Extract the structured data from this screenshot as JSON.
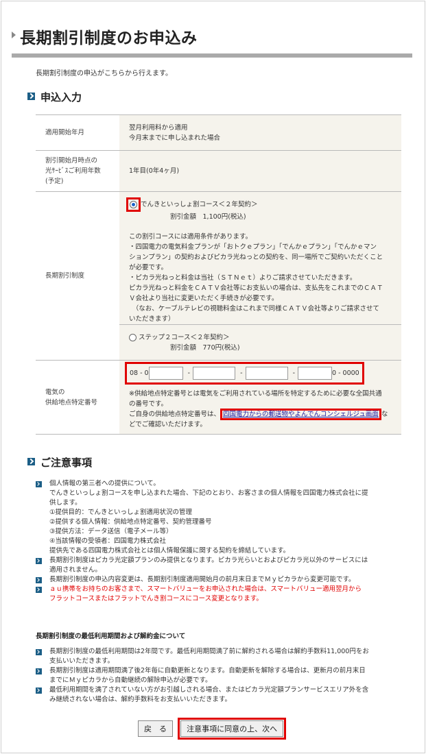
{
  "page": {
    "title": "長期割引制度のお申込み",
    "intro": "長期割引制度の申込がこちらから行えます。"
  },
  "sections": {
    "input_title": "申込入力",
    "notes_title": "ご注意事項"
  },
  "form": {
    "start_label": "適用開始年月",
    "start_value_1": "翌月利用料から適用",
    "start_value_2": "今月末までに申し込まれた場合",
    "years_label_1": "割引開始月時点の",
    "years_label_2": "光ｻｰﾋﾞｽご利用年数",
    "years_label_3": "(予定)",
    "years_value": "1年目(0年4ヶ月)",
    "plan_label": "長期割引制度",
    "option1_label": "でんきといっしょ割コース＜２年契約＞",
    "option1_amount": "割引金額　1,100円(税込)",
    "condition_lines": [
      "この割引コースには適用条件があります。",
      "・四国電力の電気料金プランが「おトクｅプラン」「でんかｅプラン」「でんかｅマン",
      "ションプラン」の契約およびピカラ光ねっとの契約を、同一場所でご契約いただくこと",
      "が必要です。",
      "・ピカラ光ねっと料金は当社（ＳＴＮｅｔ）よりご請求させていただきます。",
      "ピカラ光ねっと料金をＣＡＴＶ会社等にお支払いの場合は、支払先をこれまでのＣＡＴ",
      "Ｖ会社より当社に変更いただく手続きが必要です。",
      "　（なお、ケーブルテレビの視聴料金はこれまで同様ＣＡＴＶ会社等よりご請求させて",
      "いただきます）"
    ],
    "option2_label": "ステップ２コース＜２年契約＞",
    "option2_amount": "割引金額　770円(税込)",
    "supply_label_1": "電気の",
    "supply_label_2": "供給地点特定番号",
    "supply_prefix": "08 - 0",
    "supply_dash": "-",
    "supply_suffix": "0 - 0000",
    "supply_note_1": "※供給地点特定番号とは電気をご利用されている場所を特定するために必要な全国共通",
    "supply_note_2": "の番号です。",
    "supply_note_3": "ご自身の供給地点特定番号は、",
    "supply_link": "四国電力からの郵送物やよんでんコンシェルジュ画面",
    "supply_note_4": "な",
    "supply_note_5": "どでご確認いただけます。"
  },
  "notes": [
    {
      "lines": [
        "個人情報の第三者への提供について。",
        "でんきといっしょ割コースを申し込まれた場合、下記のとおり、お客さまの個人情報を四国電力株式会社に提",
        "供します。",
        "①提供目的：でんきといっしょ割適用状況の管理",
        "②提供する個人情報：供給地点特定番号、契約管理番号",
        "③提供方法：データ送信（電子メール等）",
        "④当該情報の受領者：四国電力株式会社",
        "提供先である四国電力株式会社とは個人情報保護に関する契約を締結しています。"
      ],
      "red": false
    },
    {
      "lines": [
        "長期割引制度はピカラ光定額プランのみ提供となります。ピカラ光らいとおよびピカラ光以外のサービスには",
        "適用されません。"
      ],
      "red": false
    },
    {
      "lines": [
        "長期割引制度の申込内容変更は、長期割引制度適用開始月の前月末日までＭｙピカラから変更可能です。"
      ],
      "red": false
    },
    {
      "lines": [
        "ａｕ携帯をお持ちのお客さまで、スマートバリューをお申込された場合は、スマートバリュー適用翌月から",
        "フラットコースまたはフラットでんき割コースにコース変更となります。"
      ],
      "red": true
    }
  ],
  "min_period": {
    "title": "長期割引制度の最低利用期間および解約金について",
    "items": [
      [
        "長期割引制度の最低利用期間は2年間です。最低利用期間満了前に解約される場合は解約手数料11,000円をお",
        "支払いいただきます。"
      ],
      [
        "長期割引制度は適用期間満了後2年毎に自動更新となります。自動更新を解除する場合は、更新月の前月末日",
        "までにＭｙピカラから自動継続の解除申込が必要です。"
      ],
      [
        "最低利用期間を満了されていない方がお引越しされる場合、またはピカラ光定額プランサービスエリア外を含",
        "み継続されない場合は、解約手数料をお支払いいただきます。"
      ]
    ]
  },
  "buttons": {
    "back": "戻　る",
    "next": "注意事項に同意の上、次へ"
  },
  "colors": {
    "highlight": "#e00000",
    "icon": "#1b5e86",
    "value_bg": "#f5f3ec",
    "rule": "#aaaaaa"
  }
}
